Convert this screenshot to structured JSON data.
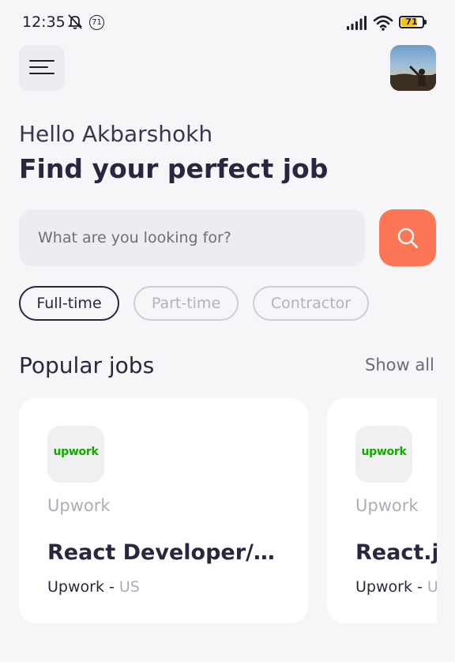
{
  "status_bar": {
    "time": "12:35",
    "notification_count": "71",
    "battery_level": "71",
    "icons": [
      "mute-icon",
      "signal-icon",
      "wifi-icon",
      "battery-icon"
    ]
  },
  "header": {
    "menu_icon": "hamburger-menu-icon",
    "avatar": "user-avatar-photo"
  },
  "greeting": "Hello Akbarshokh",
  "headline": "Find your perfect job",
  "search": {
    "placeholder": "What are you looking for?",
    "value": "",
    "button_icon": "search-icon",
    "button_color": "#fc7655"
  },
  "filters": [
    {
      "label": "Full-time",
      "active": true
    },
    {
      "label": "Part-time",
      "active": false
    },
    {
      "label": "Contractor",
      "active": false
    }
  ],
  "popular": {
    "title": "Popular jobs",
    "show_all": "Show all",
    "jobs": [
      {
        "logo_text": "upwork",
        "company": "Upwork",
        "title": "React Developer/Ar...",
        "employer": "Upwork",
        "separator": " - ",
        "location": "US"
      },
      {
        "logo_text": "upwork",
        "company": "Upwork",
        "title": "React.js",
        "employer": "Upwork",
        "separator": " - ",
        "location": "U"
      }
    ]
  },
  "colors": {
    "background": "#f6f6f9",
    "accent": "#fc7655",
    "text_primary": "#2b2640",
    "brand_upwork": "#14a800"
  }
}
